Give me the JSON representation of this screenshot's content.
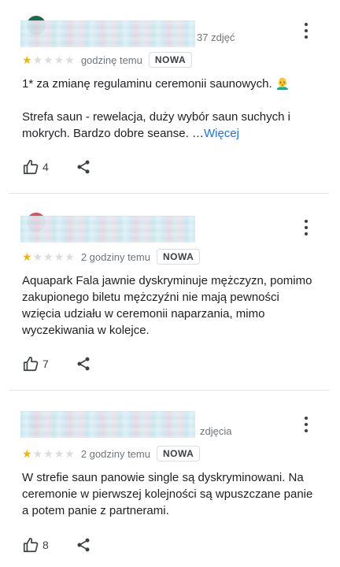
{
  "reviews": [
    {
      "photos": "37 zdjęć",
      "stars_filled": 1,
      "stars_total": 5,
      "time": "godzinę temu",
      "badge": "NOWA",
      "p1": "1* za zmianę regulaminu ceremonii saunowych.",
      "emoji": "👨‍🦲",
      "p2": "Strefa saun - rewelacja, duży wybór saun suchych i mokrych. Bardzo dobre seanse. …",
      "more": "Więcej",
      "likes": "4",
      "avatar_color": "#1e6b4a"
    },
    {
      "photos": "",
      "stars_filled": 1,
      "stars_total": 5,
      "time": "2 godziny temu",
      "badge": "NOWA",
      "p1": "Aquapark Fala jawnie dyskryminuje mężczyzn, pomimo zakupionego biletu mężczyźni nie mają pewności wzięcia udziału w ceremonii naparzania, mimo wyczekiwania w kolejce.",
      "likes": "7",
      "avatar_color": "#d8505c"
    },
    {
      "photos": "zdjęcia",
      "stars_filled": 1,
      "stars_total": 5,
      "time": "2 godziny temu",
      "badge": "NOWA",
      "p1": "W strefie saun panowie single są dyskryminowani. Na ceremonie w pierwszej kolejności są wpuszczane panie a potem panie z partnerami.",
      "likes": "8",
      "avatar_color": "#e7c6d3"
    }
  ]
}
